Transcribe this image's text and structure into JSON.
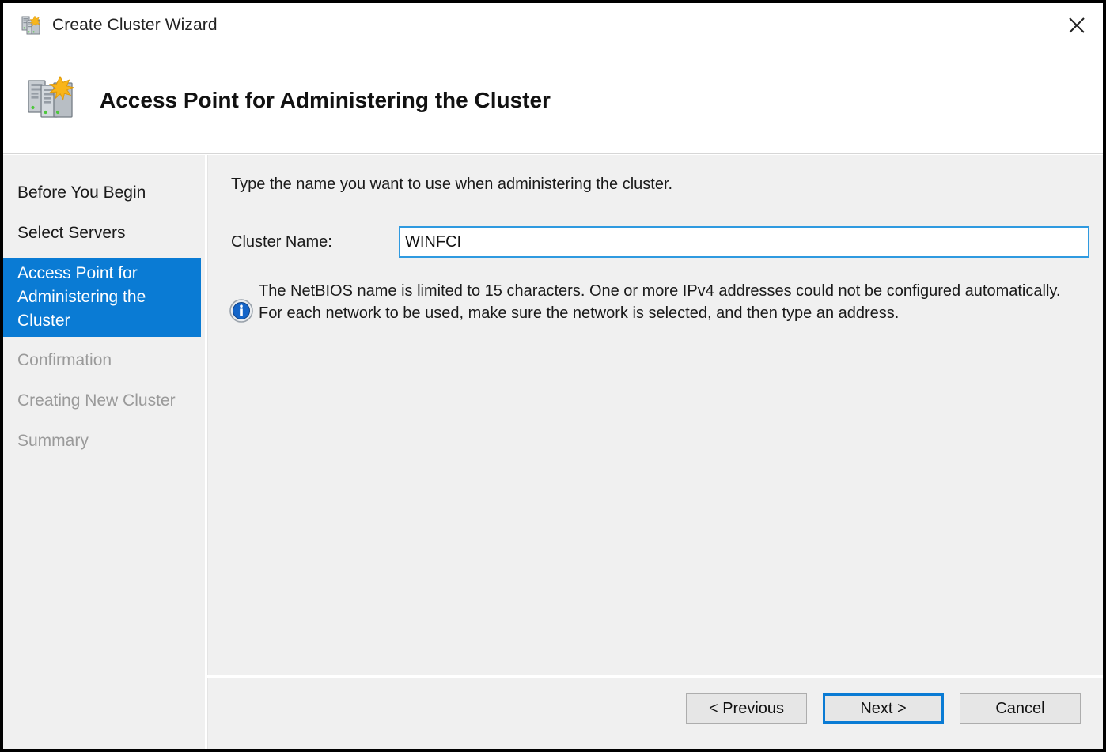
{
  "window": {
    "title": "Create Cluster Wizard",
    "titlebar_icon": "cluster-servers-icon",
    "close_icon": "close-icon"
  },
  "header": {
    "title": "Access Point for Administering the Cluster",
    "icon": "cluster-servers-icon"
  },
  "sidebar": {
    "items": [
      {
        "label": "Before You Begin",
        "state": "normal"
      },
      {
        "label": "Select Servers",
        "state": "normal"
      },
      {
        "label": "Access Point for Administering the Cluster",
        "state": "selected"
      },
      {
        "label": "Confirmation",
        "state": "disabled"
      },
      {
        "label": "Creating New Cluster",
        "state": "disabled"
      },
      {
        "label": "Summary",
        "state": "disabled"
      }
    ]
  },
  "content": {
    "intro": "Type the name you want to use when administering the cluster.",
    "cluster_name_label": "Cluster Name:",
    "cluster_name_value": "WINFCI",
    "cluster_name_placeholder": "",
    "info_icon": "info-icon",
    "info_message": "The NetBIOS name is limited to 15 characters.  One or more IPv4 addresses could not be configured automatically.  For each network to be used, make sure the network is selected, and then type an address."
  },
  "footer": {
    "previous_label": "< Previous",
    "next_label": "Next >",
    "cancel_label": "Cancel"
  },
  "colors": {
    "accent": "#0a7bd4",
    "panel_bg": "#f0f0f0",
    "window_bg": "#ffffff",
    "info_blue": "#1565c8"
  }
}
